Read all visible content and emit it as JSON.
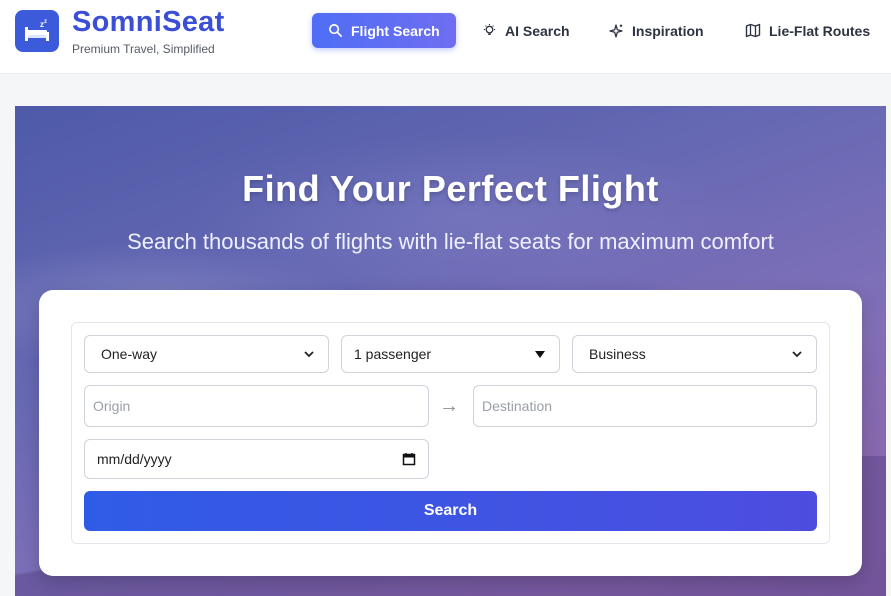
{
  "brand": {
    "name": "SomniSeat",
    "tagline": "Premium Travel, Simplified",
    "logo_icon": "bed-icon",
    "accent_color": "#3b5bdb"
  },
  "nav": {
    "items": [
      {
        "label": "Flight Search",
        "icon": "search-icon",
        "active": true
      },
      {
        "label": "AI Search",
        "icon": "lightbulb-icon",
        "active": false
      },
      {
        "label": "Inspiration",
        "icon": "sparkle-icon",
        "active": false
      },
      {
        "label": "Lie-Flat Routes",
        "icon": "map-icon",
        "active": false
      }
    ]
  },
  "hero": {
    "title": "Find Your Perfect Flight",
    "subtitle": "Search thousands of flights with lie-flat seats for maximum comfort"
  },
  "form": {
    "trip_type": "One-way",
    "passengers": "1 passenger",
    "cabin_class": "Business",
    "origin_placeholder": "Origin",
    "destination_placeholder": "Destination",
    "arrow": "→",
    "date_placeholder": "mm/dd/yyyy",
    "search_label": "Search"
  }
}
